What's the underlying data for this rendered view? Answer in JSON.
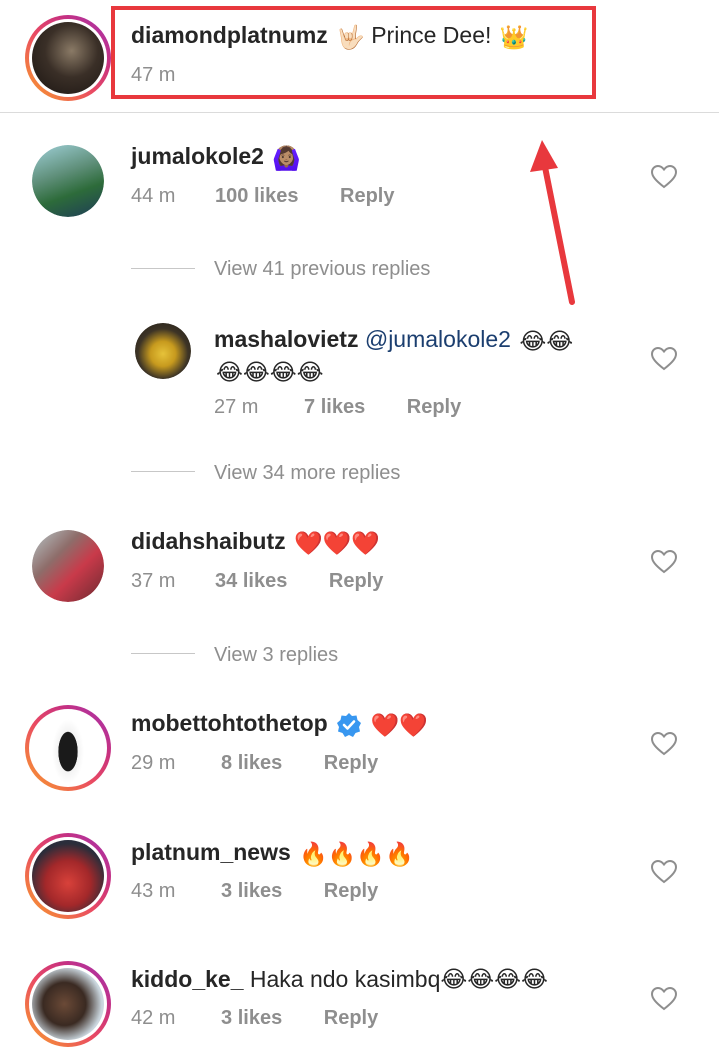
{
  "colors": {
    "annotation_red": "#e8383d",
    "meta_grey": "#8e8e8e",
    "mention_blue": "#1b3e6f",
    "verified_blue": "#3897f0"
  },
  "caption": {
    "username": "diamondplatnumz",
    "hand_emoji": "🤟🏻",
    "text": "Prince Dee!",
    "crown_emoji": "👑",
    "time": "47 m"
  },
  "comments": [
    {
      "username": "jumalokole2",
      "text": "🙆🏽‍♀️",
      "time": "44 m",
      "likes": "100 likes",
      "reply": "Reply"
    },
    {
      "username": "didahshaibutz",
      "text": "❤️❤️❤️",
      "time": "37 m",
      "likes": "34 likes",
      "reply": "Reply"
    },
    {
      "username": "mobettohtothetop",
      "verified_icon": "verified-badge-icon",
      "text": "❤️❤️",
      "time": "29 m",
      "likes": "8 likes",
      "reply": "Reply"
    },
    {
      "username": "platnum_news",
      "text": "🔥🔥🔥🔥",
      "time": "43 m",
      "likes": "3 likes",
      "reply": "Reply"
    },
    {
      "username": "kiddo_ke_",
      "text": "Haka ndo kasimbq😂😂😂😂",
      "time": "42 m",
      "likes": "3 likes",
      "reply": "Reply"
    }
  ],
  "reply_thread": {
    "view_previous": "View 41 previous replies",
    "reply": {
      "username": "mashalovietz",
      "mention": "@jumalokole2",
      "text_line1": "😂😂",
      "text_line2": "😂😂😂😂",
      "time": "27 m",
      "likes": "7 likes",
      "reply": "Reply"
    },
    "view_more": "View 34 more replies"
  },
  "view_replies_didah": "View 3 replies",
  "icons": {
    "like": "heart-outline-icon",
    "annotation": "red-arrow-annotation"
  }
}
